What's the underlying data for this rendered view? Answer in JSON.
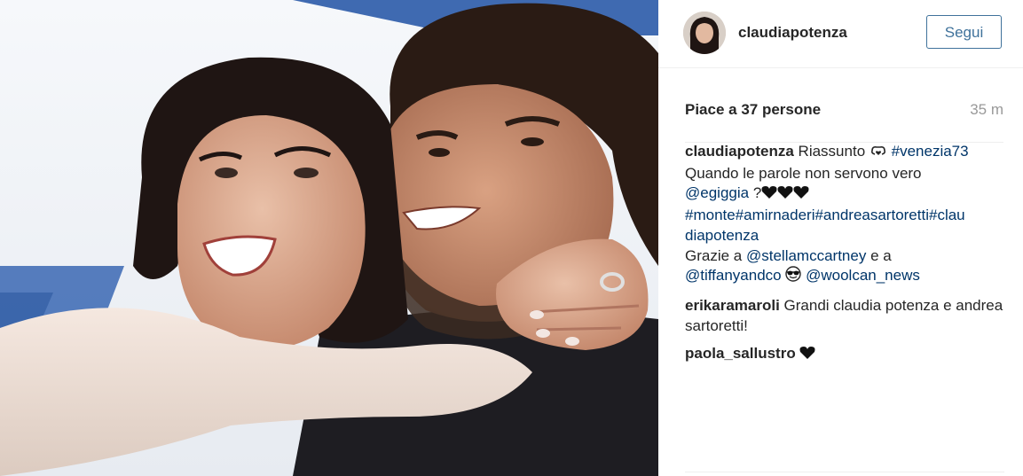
{
  "post": {
    "username": "claudiapotenza",
    "follow_label": "Segui",
    "likes_text": "Piace a 37 persone",
    "time_ago": "35 m"
  },
  "caption": {
    "author": "claudiapotenza",
    "text1": "Riassunto",
    "icon1": "gift-heart-icon",
    "hashtag1": "#venezia73",
    "line2": "Quando le parole non servono vero",
    "mention1": "@egiggia",
    "after_mention1": "?",
    "hearts_icon": "black-hearts-icon",
    "hashtags_line_a": "#monte#amirnaderi#andreasartoretti#clau",
    "hashtags_line_b": "diapotenza",
    "thanks_prefix": "Grazie a",
    "mention2": "@stellamccartney",
    "thanks_and": "e a",
    "mention3": "@tiffanyandco",
    "icon2": "sunglasses-emoji-icon",
    "mention4": "@woolcan_news"
  },
  "comments": [
    {
      "author": "erikaramaroli",
      "text": "Grandi claudia potenza e andrea sartoretti!"
    },
    {
      "author": "paola_sallustro",
      "text": "",
      "icon": "black-heart-icon"
    }
  ],
  "colors": {
    "link": "#003569",
    "follow": "#3f729b",
    "muted": "#999999",
    "text": "#262626"
  }
}
